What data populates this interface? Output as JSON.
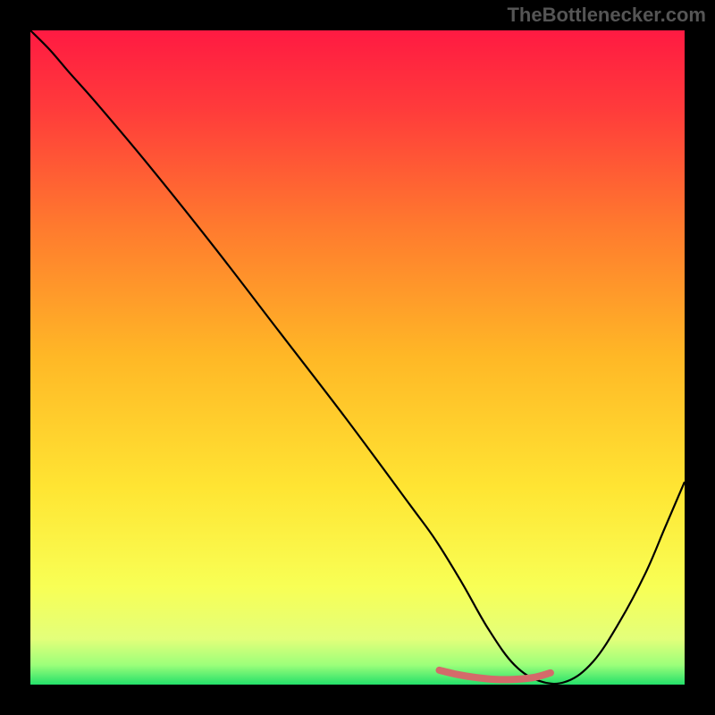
{
  "watermark": "TheBottlenecker.com",
  "chart_data": {
    "type": "line",
    "title": "",
    "xlabel": "",
    "ylabel": "",
    "xlim": [
      0,
      100
    ],
    "ylim": [
      0,
      100
    ],
    "grid": false,
    "legend": false,
    "background": {
      "type": "vertical-gradient",
      "stops": [
        {
          "pos": 0.0,
          "color": "#ff1a42"
        },
        {
          "pos": 0.12,
          "color": "#ff3b3b"
        },
        {
          "pos": 0.3,
          "color": "#ff7a2e"
        },
        {
          "pos": 0.5,
          "color": "#ffb826"
        },
        {
          "pos": 0.7,
          "color": "#ffe533"
        },
        {
          "pos": 0.85,
          "color": "#f8ff55"
        },
        {
          "pos": 0.93,
          "color": "#e3ff7a"
        },
        {
          "pos": 0.97,
          "color": "#9cff7a"
        },
        {
          "pos": 1.0,
          "color": "#24e06a"
        }
      ]
    },
    "series": [
      {
        "name": "bottleneck-curve",
        "color": "#000000",
        "width": 2.2,
        "x": [
          0.0,
          3.0,
          6.0,
          10.0,
          18.0,
          28.0,
          38.0,
          48.0,
          58.0,
          62.0,
          66.0,
          70.0,
          74.0,
          78.0,
          82.0,
          86.0,
          90.0,
          94.0,
          97.0,
          100.0
        ],
        "y": [
          100.0,
          97.0,
          93.5,
          89.0,
          79.5,
          67.0,
          54.0,
          41.0,
          27.5,
          22.0,
          15.5,
          8.5,
          3.0,
          0.5,
          0.5,
          3.5,
          9.5,
          17.0,
          24.0,
          31.0
        ]
      },
      {
        "name": "highlight-band",
        "color": "#d46a6a",
        "width": 8,
        "x": [
          62.5,
          65.0,
          68.0,
          71.0,
          74.0,
          77.0,
          79.5
        ],
        "y": [
          2.2,
          1.6,
          1.1,
          0.8,
          0.8,
          1.1,
          1.8
        ]
      }
    ]
  }
}
